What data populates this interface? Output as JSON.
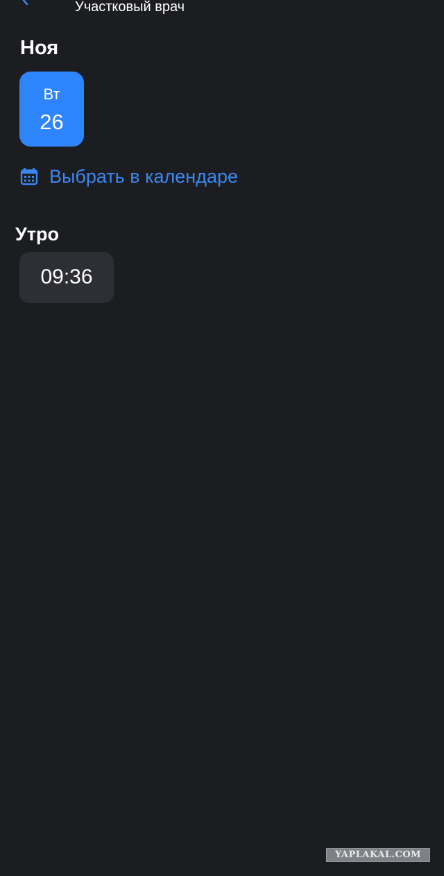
{
  "header": {
    "subtitle": "Участковый врач",
    "back_icon": "chevron-left-icon"
  },
  "month": {
    "label": "Ноя"
  },
  "dates": [
    {
      "weekday": "Вт",
      "day": "26",
      "selected": true
    }
  ],
  "calendar_link": {
    "icon": "calendar-icon",
    "label": "Выбрать в календаре"
  },
  "periods": [
    {
      "title": "Утро",
      "slots": [
        {
          "time": "09:36"
        }
      ]
    }
  ],
  "watermark": {
    "text": "YAPLAKAL.COM"
  },
  "colors": {
    "background": "#1c1d20",
    "accent": "#2d84fb",
    "link": "#3b86ef",
    "slot_background": "#2e2f34",
    "text": "#ffffff"
  }
}
